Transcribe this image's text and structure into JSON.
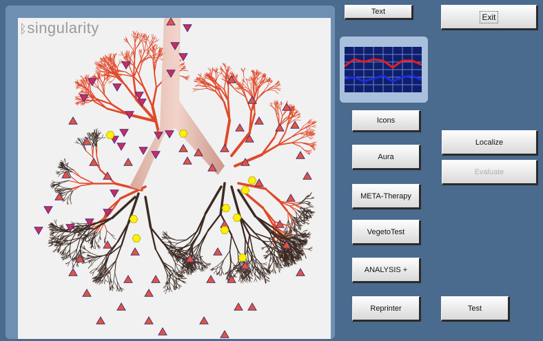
{
  "logo": {
    "text": "singularity"
  },
  "buttons": {
    "text": "Text",
    "exit": "Exit",
    "icons": "Icons",
    "aura": "Aura",
    "meta_therapy": "META-Therapy",
    "vegeto_test": "VegetoTest",
    "analysis": "ANALYSIS +",
    "reprinter": "Reprinter",
    "localize": "Localize",
    "evaluate": "Evaluate",
    "test": "Test"
  },
  "button_states": {
    "evaluate_enabled": false
  },
  "colors": {
    "marker_high": "#e4572e",
    "marker_low": "#cc2d59",
    "marker_normal": "#fff200",
    "graph_red": "#e02020",
    "graph_blue": "#1a2fe0",
    "panel_bg": "#4a6a8e"
  },
  "icons": {
    "graph": "graph-thumbnail-icon",
    "logo_mark": "singularity-logo-mark"
  }
}
